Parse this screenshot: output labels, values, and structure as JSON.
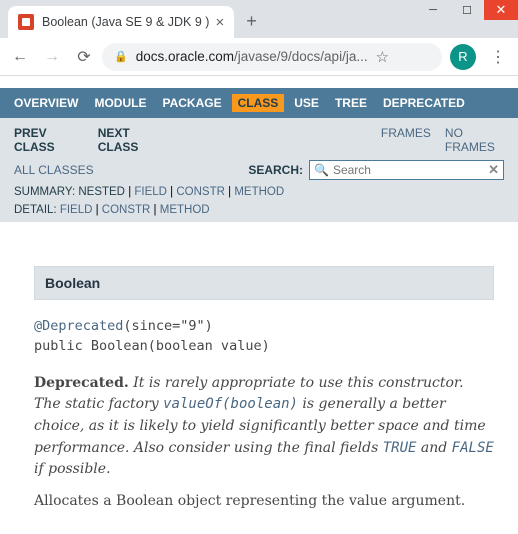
{
  "window": {
    "tab_title": "Boolean (Java SE 9 & JDK 9 )",
    "url_domain": "docs.oracle.com",
    "url_path": "/javase/9/docs/api/ja...",
    "avatar_letter": "R"
  },
  "nav": {
    "items": [
      "OVERVIEW",
      "MODULE",
      "PACKAGE",
      "CLASS",
      "USE",
      "TREE",
      "DEPRECATED"
    ],
    "prev": "PREV CLASS",
    "next": "NEXT CLASS",
    "frames": "FRAMES",
    "noframes": "NO FRAMES",
    "allclasses": "ALL CLASSES",
    "search_label": "SEARCH:",
    "search_placeholder": "Search",
    "summary_label": "SUMMARY:",
    "summary_items": [
      "NESTED",
      "FIELD",
      "CONSTR",
      "METHOD"
    ],
    "detail_label": "DETAIL:",
    "detail_items": [
      "FIELD",
      "CONSTR",
      "METHOD"
    ]
  },
  "doc": {
    "heading": "Boolean",
    "annotation": "@Deprecated",
    "annotation_args": "(since=\"9\")",
    "modifiers": "public Boolean(boolean value)",
    "dep_label": "Deprecated.",
    "dep_t1": " It is rarely appropriate to use this constructor. The static factory ",
    "dep_link1": "valueOf(boolean)",
    "dep_t2": " is generally a better choice, as it is likely to yield significantly better space and time performance. Also consider using the final fields ",
    "dep_link2": "TRUE",
    "dep_t3": " and ",
    "dep_link3": "FALSE",
    "dep_t4": " if possible.",
    "para_t1": "Allocates a Boolean object representing the ",
    "para_code": "value",
    "para_t2": " argument."
  }
}
